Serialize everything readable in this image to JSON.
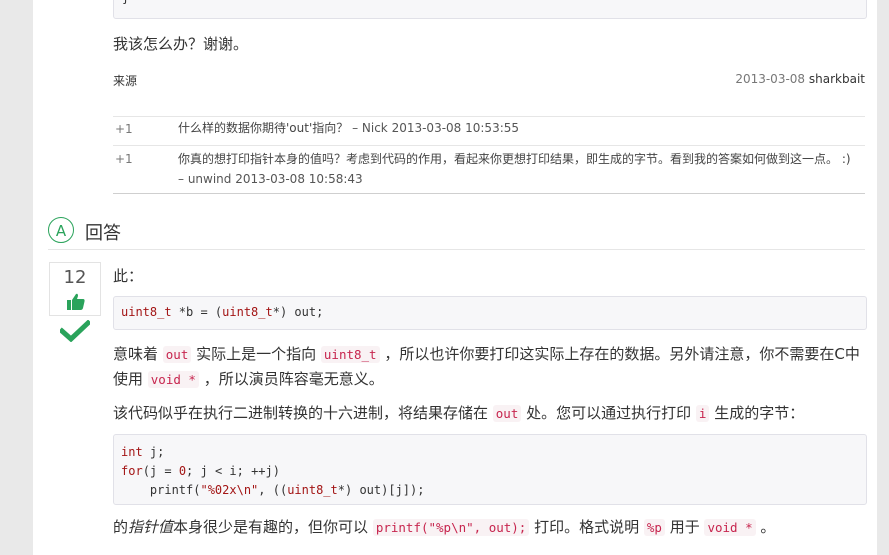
{
  "question": {
    "code_tail": "}",
    "closing_text": "我该怎么办？谢谢。",
    "source_label": "来源",
    "date": "2013-03-08",
    "author": "sharkbait"
  },
  "comments": [
    {
      "votes": "+1",
      "text": "什么样的数据你期待'out'指向？",
      "meta": " – Nick 2013-03-08 10:53:55"
    },
    {
      "votes": "+1",
      "text": "你真的想打印指针本身的值吗？考虑到代码的作用，看起来你更想打印结果，即生成的字节。看到我的答案如何做到这一点。 :)",
      "meta": " – unwind 2013-03-08 10:58:43"
    }
  ],
  "answers_header": {
    "badge": "A",
    "title": "回答"
  },
  "answer": {
    "votes": "12",
    "intro": "此：",
    "code1": "uint8_t *b = (uint8_t*) out;",
    "p1_a": "意味着 ",
    "p1_code1": "out",
    "p1_b": " 实际上是一个指向 ",
    "p1_code2": "uint8_t",
    "p1_c": " ，所以也许你要打印这实际上存在的数据。另外请注意，你不需要在C中使用 ",
    "p1_code3": "void *",
    "p1_d": " ，所以演员阵容毫无意义。",
    "p2_a": "该代码似乎在执行二进制转换的十六进制，将结果存储在 ",
    "p2_code1": "out",
    "p2_b": " 处。您可以通过执行打印 ",
    "p2_code2": "i",
    "p2_c": " 生成的字节：",
    "code2_lines": [
      "int j;",
      "for(j = 0; j < i; ++j)",
      "    printf(\"%02x\\n\", ((uint8_t*) out)[j]);"
    ],
    "p3_a": "的",
    "p3_em": "指针值",
    "p3_b": "本身很少是有趣的，但你可以 ",
    "p3_code1": "printf(\"%p\\n\", out);",
    "p3_c": " 打印。格式说明 ",
    "p3_code2": "%p",
    "p3_d": " 用于 ",
    "p3_code3": "void *",
    "p3_e": " 。"
  },
  "colors": {
    "accent_green": "#2aa35b",
    "code_red": "#c7254e"
  },
  "icons": [
    "thumbs-up-icon",
    "accepted-check-icon"
  ]
}
